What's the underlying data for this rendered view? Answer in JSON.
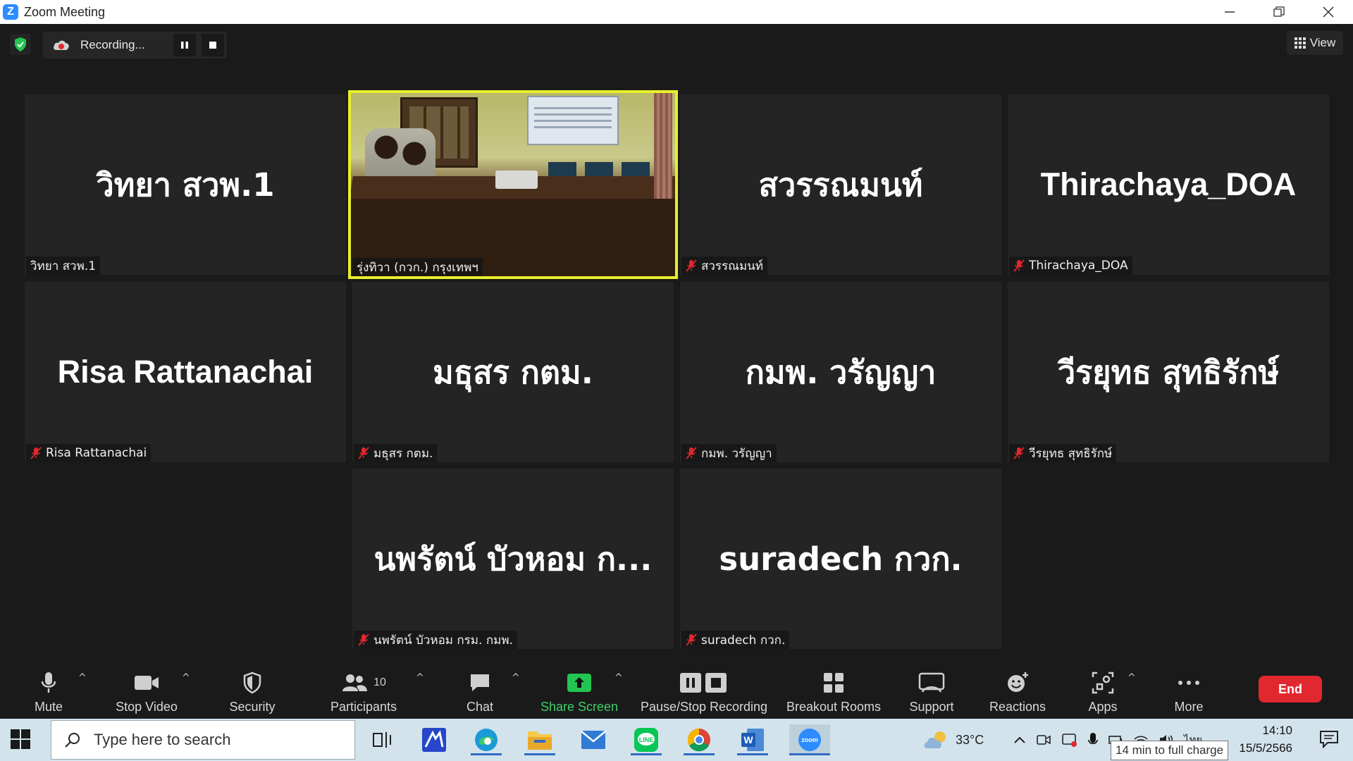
{
  "window": {
    "title": "Zoom Meeting",
    "logo_letter": "Z"
  },
  "topbar": {
    "recording_label": "Recording...",
    "view_label": "View"
  },
  "tiles": [
    {
      "big_name": "วิทยา สวพ.1",
      "label": "วิทยา สวพ.1",
      "muted": false
    },
    {
      "big_name": "",
      "label": "รุ่งทิวา (กวก.) กรุงเทพฯ",
      "muted": false,
      "video": true
    },
    {
      "big_name": "สวรรณมนท์",
      "label": "สวรรณมนท์",
      "muted": true
    },
    {
      "big_name": "Thirachaya_DOA",
      "label": "Thirachaya_DOA",
      "muted": true
    },
    {
      "big_name": "Risa Rattanachai",
      "label": "Risa Rattanachai",
      "muted": true
    },
    {
      "big_name": "มธุสร กตม.",
      "label": "มธุสร กตม.",
      "muted": true
    },
    {
      "big_name": "กมพ. วรัญญา",
      "label": "กมพ. วรัญญา",
      "muted": true
    },
    {
      "big_name": "วีรยุทธ สุทธิรักษ์",
      "label": "วีรยุทธ สุทธิรักษ์",
      "muted": true
    },
    {
      "big_name": "นพรัตน์ บัวหอม ก...",
      "label": "นพรัตน์ บัวหอม กรม. กมพ.",
      "muted": true
    },
    {
      "big_name": "suradech กวก.",
      "label": "suradech กวก.",
      "muted": true
    }
  ],
  "toolbar": {
    "mute": "Mute",
    "stop_video": "Stop Video",
    "security": "Security",
    "participants": "Participants",
    "participants_count": "10",
    "chat": "Chat",
    "share_screen": "Share Screen",
    "pause_stop_recording": "Pause/Stop Recording",
    "breakout_rooms": "Breakout Rooms",
    "support": "Support",
    "reactions": "Reactions",
    "apps": "Apps",
    "more": "More",
    "end": "End"
  },
  "taskbar": {
    "search_placeholder": "Type here to search",
    "weather": "33°C",
    "time": "14:10",
    "date": "15/5/2566",
    "tooltip": "14 min to full charge",
    "lang": "ไทย"
  },
  "colors": {
    "active_speaker": "#e8ef2a",
    "end_button": "#e0282e",
    "share_green": "#3ecf6a",
    "zoom_blue": "#2d8cff"
  }
}
